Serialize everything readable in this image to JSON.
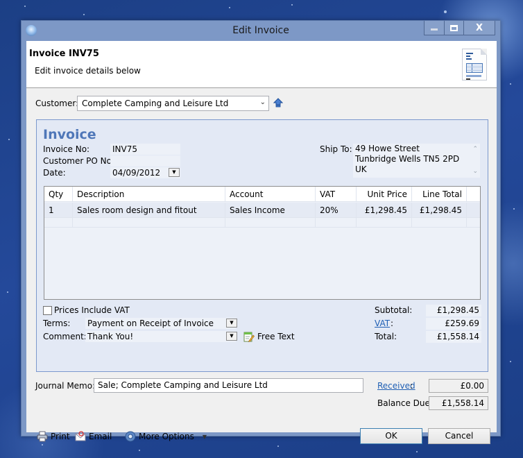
{
  "window": {
    "title": "Edit Invoice",
    "controls": {
      "minimize": "minimize",
      "maximize": "maximize",
      "close": "X"
    }
  },
  "header": {
    "title": "Invoice INV75",
    "subtitle": "Edit invoice details below",
    "icon": "invoice-document-icon"
  },
  "customer": {
    "label": "Customer:",
    "value": "Complete Camping and Leisure Ltd",
    "icon": "up-arrow-icon"
  },
  "invoice": {
    "heading": "Invoice",
    "invoice_no_label": "Invoice No:",
    "invoice_no": "INV75",
    "po_label": "Customer PO No:",
    "po_value": "",
    "date_label": "Date:",
    "date_value": "04/09/2012",
    "ship_to_label": "Ship To:",
    "ship_to_lines": [
      "49 Howe Street",
      "Tunbridge Wells TN5 2PD",
      "UK"
    ]
  },
  "lines": {
    "columns": [
      "Qty",
      "Description",
      "Account",
      "VAT",
      "Unit Price",
      "Line Total"
    ],
    "rows": [
      {
        "qty": "1",
        "description": "Sales room design and fitout",
        "account": "Sales Income",
        "vat": "20%",
        "unit_price": "£1,298.45",
        "line_total": "£1,298.45"
      }
    ]
  },
  "options": {
    "prices_include_vat_label": "Prices Include VAT",
    "prices_include_vat_checked": false,
    "terms_label": "Terms:",
    "terms_value": "Payment on Receipt of Invoice",
    "comment_label": "Comment:",
    "comment_value": "Thank You!",
    "free_text_label": "Free Text"
  },
  "totals": {
    "subtotal_label": "Subtotal:",
    "subtotal": "£1,298.45",
    "vat_label": "VAT",
    "vat": "£259.69",
    "total_label": "Total:",
    "total": "£1,558.14",
    "received_label": "Received",
    "received": "£0.00",
    "balance_due_label": "Balance Due:",
    "balance_due": "£1,558.14"
  },
  "memo": {
    "label": "Journal Memo:",
    "value": "Sale; Complete Camping and Leisure Ltd"
  },
  "footer": {
    "print_label": "Print",
    "email_label": "Email",
    "more_options_label": "More Options",
    "ok_label": "OK",
    "cancel_label": "Cancel"
  }
}
